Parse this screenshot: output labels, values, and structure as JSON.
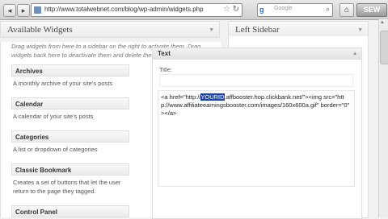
{
  "browser": {
    "url": "http://www.totalwebnet.com/blog/wp-admin/widgets.php",
    "search_placeholder": "Google",
    "extension_label": "SEW"
  },
  "available_widgets": {
    "title": "Available Widgets",
    "description": "Drag widgets from here to a sidebar on the right to activate them. Drag widgets back here to deactivate them and delete their settings.",
    "widgets": [
      {
        "name": "Archives",
        "desc": "A monthly archive of your site's posts"
      },
      {
        "name": "Calendar",
        "desc": "A calendar of your site's posts"
      },
      {
        "name": "Categories",
        "desc": "A list or dropdown of categories"
      },
      {
        "name": "Classic Bookmark",
        "desc": "Creates a set of buttons that let the user return to the page they tagged."
      },
      {
        "name": "Control Panel",
        "desc": ""
      }
    ]
  },
  "left_sidebar": {
    "title": "Left Sidebar"
  },
  "text_widget": {
    "header": "Text",
    "title_label": "Title:",
    "title_value": "",
    "content_before": "<a href=\"http://",
    "content_selected": "YOURID",
    "content_after": ".affbooster.hop.clickbank.net/\"><img src=\"http://www.affiliateearningsbooster.com/images/160x600a.gif\" border=\"0\" ></a>"
  }
}
